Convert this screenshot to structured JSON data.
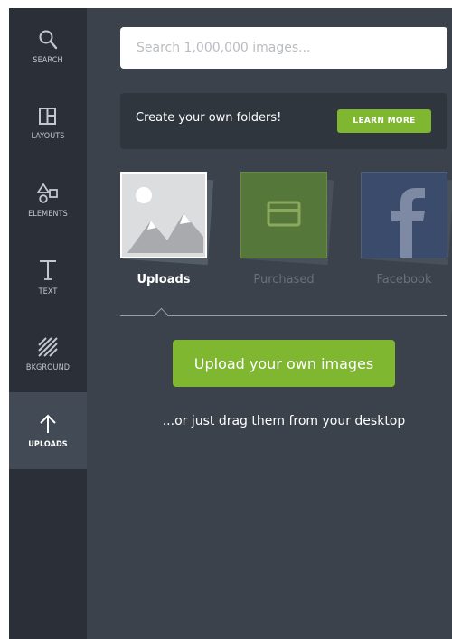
{
  "sidebar": {
    "items": [
      {
        "label": "SEARCH",
        "icon": "search-icon"
      },
      {
        "label": "LAYOUTS",
        "icon": "layouts-icon"
      },
      {
        "label": "ELEMENTS",
        "icon": "elements-icon"
      },
      {
        "label": "TEXT",
        "icon": "text-icon"
      },
      {
        "label": "BKGROUND",
        "icon": "background-icon"
      },
      {
        "label": "UPLOADS",
        "icon": "upload-arrow-icon",
        "active": true
      }
    ]
  },
  "search": {
    "placeholder": "Search 1,000,000 images..."
  },
  "banner": {
    "text": "Create your own folders!",
    "button_label": "LEARN MORE"
  },
  "folders": [
    {
      "label": "Uploads",
      "icon": "image-placeholder-icon",
      "selected": true
    },
    {
      "label": "Purchased",
      "icon": "credit-card-icon",
      "selected": false
    },
    {
      "label": "Facebook",
      "icon": "facebook-icon",
      "selected": false
    }
  ],
  "upload": {
    "button_label": "Upload your own images",
    "drag_text": "...or just drag them from your desktop"
  },
  "colors": {
    "sidebar_bg": "#2b3038",
    "panel_bg": "#3b424b",
    "accent_green": "#7fb731",
    "banner_bg": "#30363e"
  }
}
